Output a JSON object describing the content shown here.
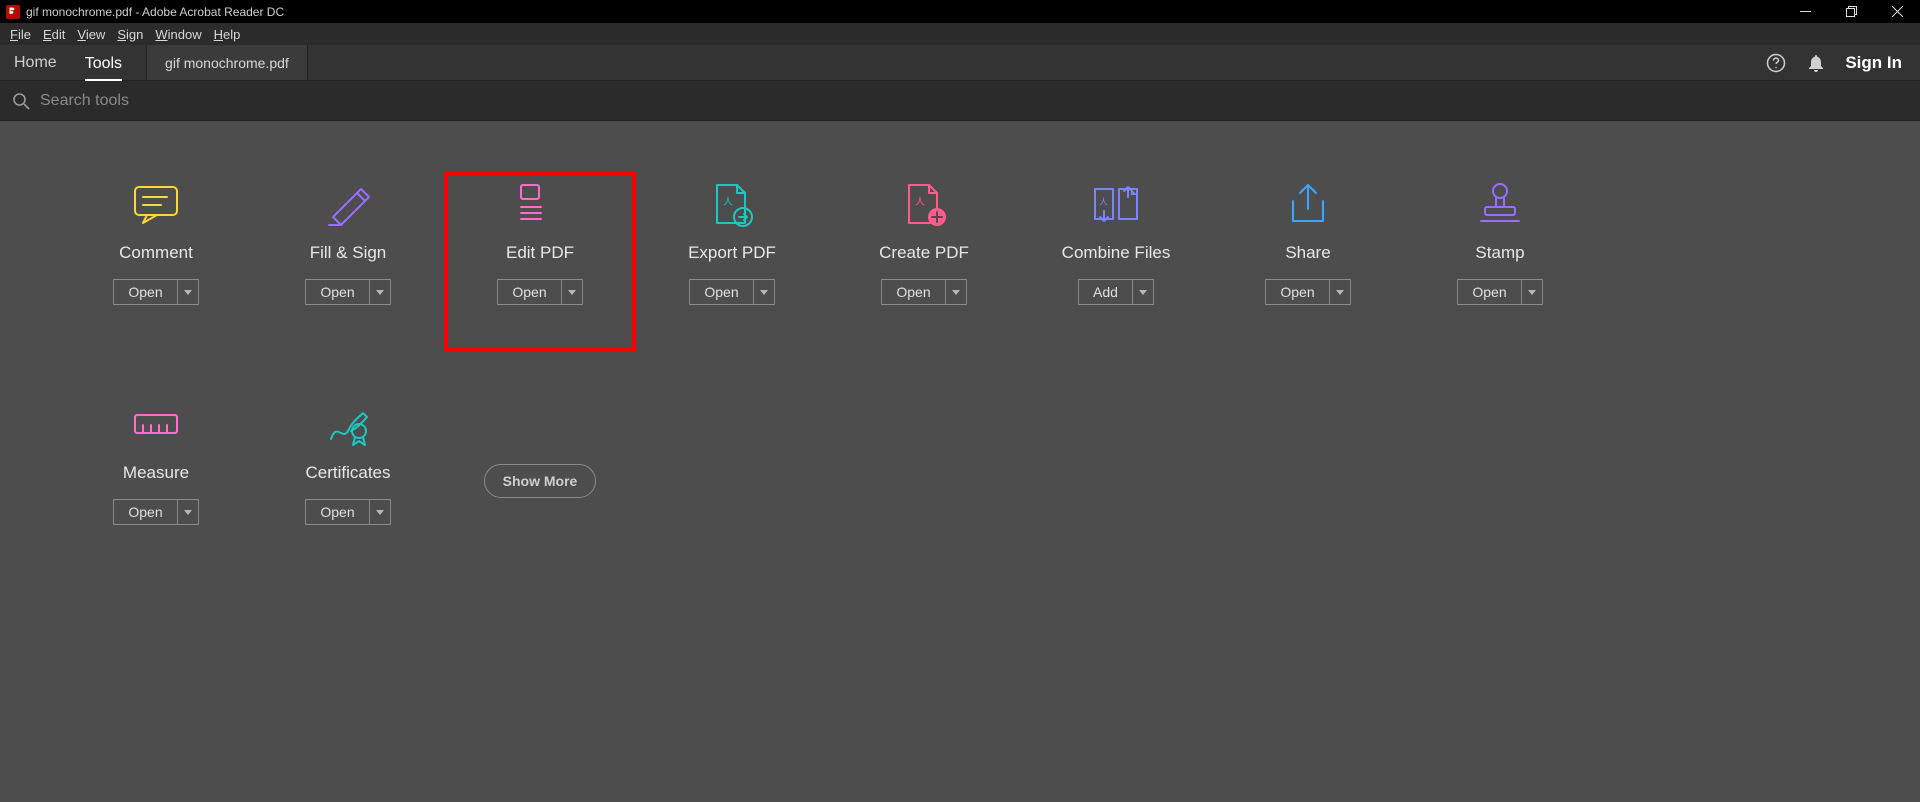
{
  "window": {
    "title": "gif monochrome.pdf - Adobe Acrobat Reader DC"
  },
  "menubar": {
    "items": [
      "File",
      "Edit",
      "View",
      "Sign",
      "Window",
      "Help"
    ]
  },
  "tabbar": {
    "nav": {
      "home": "Home",
      "tools": "Tools"
    },
    "docTab": "gif monochrome.pdf",
    "signIn": "Sign In"
  },
  "search": {
    "placeholder": "Search tools"
  },
  "tools": [
    {
      "id": "comment",
      "label": "Comment",
      "button": "Open",
      "color": "#f8d737"
    },
    {
      "id": "fillsign",
      "label": "Fill & Sign",
      "button": "Open",
      "color": "#9a6dff"
    },
    {
      "id": "editpdf",
      "label": "Edit PDF",
      "button": "Open",
      "color": "#ff6bcf",
      "highlighted": true
    },
    {
      "id": "export",
      "label": "Export PDF",
      "button": "Open",
      "color": "#1fc7c0"
    },
    {
      "id": "create",
      "label": "Create PDF",
      "button": "Open",
      "color": "#ff5c8a"
    },
    {
      "id": "combine",
      "label": "Combine Files",
      "button": "Add",
      "color": "#7b84ff"
    },
    {
      "id": "share",
      "label": "Share",
      "button": "Open",
      "color": "#3aa4ff"
    },
    {
      "id": "stamp",
      "label": "Stamp",
      "button": "Open",
      "color": "#9a6dff"
    },
    {
      "id": "measure",
      "label": "Measure",
      "button": "Open",
      "color": "#ff6bcf"
    },
    {
      "id": "certs",
      "label": "Certificates",
      "button": "Open",
      "color": "#1fc7c0"
    }
  ],
  "showMore": "Show More"
}
